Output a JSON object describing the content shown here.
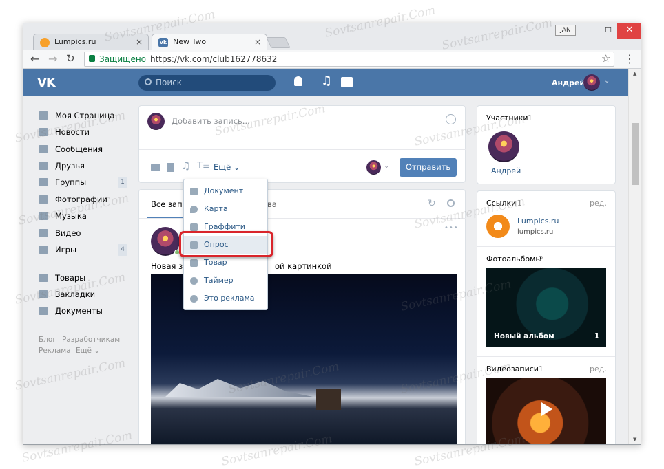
{
  "window": {
    "lang_badge": "JAN",
    "controls": {
      "min": "–",
      "max": "☐",
      "close": "✕"
    }
  },
  "tabs": [
    {
      "title": "Lumpics.ru",
      "favicon_color": "#f7a02a",
      "close": "×"
    },
    {
      "title": "New Two",
      "favicon_color": "#4a76a8",
      "favicon_text": "vk",
      "close": "×"
    }
  ],
  "toolbar": {
    "secure_label": "Защищено",
    "url": "https://vk.com/club162778632",
    "star": "☆",
    "menu": "⋮"
  },
  "vk": {
    "logo": "VK",
    "search_placeholder": "Поиск",
    "user_name": "Андрей"
  },
  "sidebar": {
    "items": [
      {
        "label": "Моя Страница"
      },
      {
        "label": "Новости"
      },
      {
        "label": "Сообщения"
      },
      {
        "label": "Друзья"
      },
      {
        "label": "Группы",
        "badge": "1"
      },
      {
        "label": "Фотографии"
      },
      {
        "label": "Музыка"
      },
      {
        "label": "Видео"
      },
      {
        "label": "Игры",
        "badge": "4"
      }
    ],
    "items2": [
      {
        "label": "Товары"
      },
      {
        "label": "Закладки"
      },
      {
        "label": "Документы"
      }
    ],
    "footer": {
      "blog": "Блог",
      "dev": "Разработчикам",
      "ads": "Реклама",
      "more": "Ещё ⌄"
    }
  },
  "composer": {
    "placeholder": "Добавить запись...",
    "more_label": "Ещё ⌄",
    "send_label": "Отправить"
  },
  "dropdown": {
    "items": [
      {
        "label": "Документ"
      },
      {
        "label": "Карта"
      },
      {
        "label": "Граффити"
      },
      {
        "label": "Опрос"
      },
      {
        "label": "Товар"
      },
      {
        "label": "Таймер"
      },
      {
        "label": "Это реклама"
      }
    ]
  },
  "wall": {
    "tab_all": "Все запи",
    "tab_other": "ва",
    "post_text_left": "Новая за",
    "post_text_right": "ой картинкой",
    "dots": "•••"
  },
  "right": {
    "members_title": "Участники",
    "members_count": "1",
    "member_name": "Андрей",
    "links_title": "Ссылки",
    "links_count": "1",
    "edit": "ред.",
    "link_name": "Lumpics.ru",
    "link_url": "lumpics.ru",
    "albums_title": "Фотоальбомы",
    "albums_count": "2",
    "album_name": "Новый альбом",
    "album_count": "1",
    "videos_title": "Видеозаписи",
    "videos_count": "1",
    "videos_edit": "ред."
  },
  "watermark": "Sovtsanrepair.Com"
}
